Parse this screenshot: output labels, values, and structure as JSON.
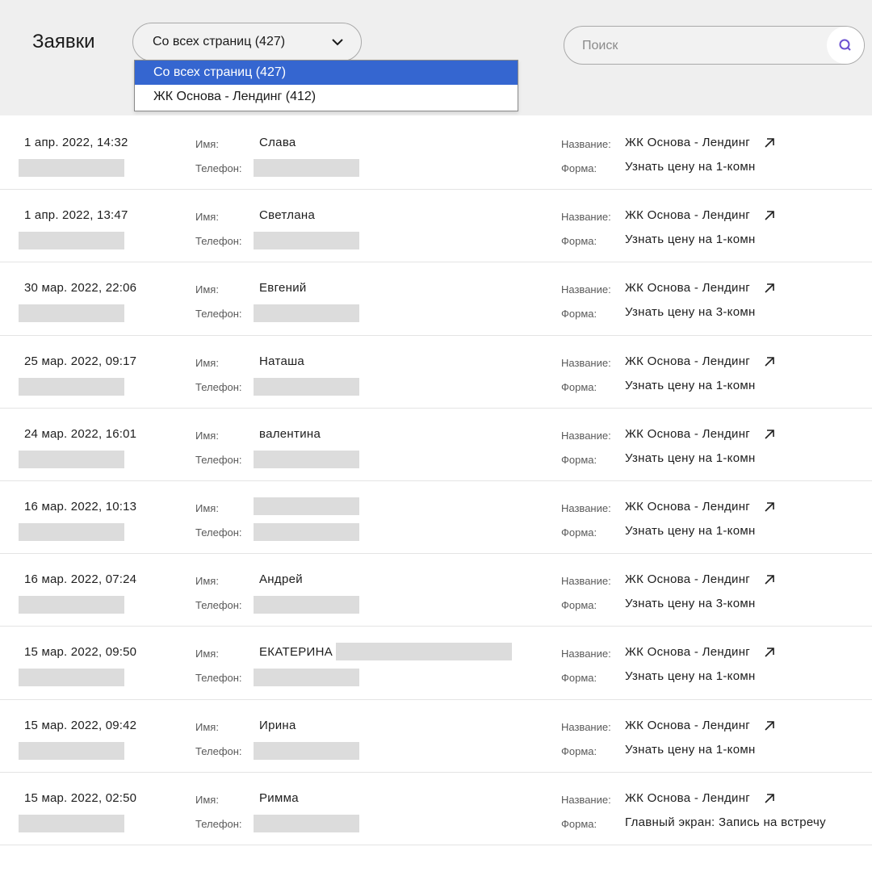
{
  "header": {
    "title": "Заявки",
    "filter_selected": "Со всех страниц (427)",
    "filter_options": [
      "Со всех страниц (427)",
      "ЖК Основа - Лендинг (412)"
    ],
    "search_placeholder": "Поиск"
  },
  "labels": {
    "name": "Имя:",
    "phone": "Телефон:",
    "title": "Название:",
    "form": "Форма:"
  },
  "rows": [
    {
      "date": "1 апр. 2022, 14:32",
      "name": "Слава",
      "title": "ЖК Основа - Лендинг",
      "form": "Узнать цену на 1-комн"
    },
    {
      "date": "1 апр. 2022, 13:47",
      "name": "Светлана",
      "title": "ЖК Основа - Лендинг",
      "form": "Узнать цену на 1-комн"
    },
    {
      "date": "30 мар. 2022, 22:06",
      "name": "Евгений",
      "title": "ЖК Основа - Лендинг",
      "form": "Узнать цену на 3-комн"
    },
    {
      "date": "25 мар. 2022, 09:17",
      "name": "Наташа",
      "title": "ЖК Основа - Лендинг",
      "form": "Узнать цену на 1-комн"
    },
    {
      "date": "24 мар. 2022, 16:01",
      "name": "валентина",
      "title": "ЖК Основа - Лендинг",
      "form": "Узнать цену на 1-комн"
    },
    {
      "date": "16 мар. 2022, 10:13",
      "name": "",
      "title": "ЖК Основа - Лендинг",
      "form": "Узнать цену на 1-комн"
    },
    {
      "date": "16 мар. 2022, 07:24",
      "name": "Андрей",
      "title": "ЖК Основа - Лендинг",
      "form": "Узнать цену на 3-комн"
    },
    {
      "date": "15 мар. 2022, 09:50",
      "name": "ЕКАТЕРИНА",
      "title": "ЖК Основа - Лендинг",
      "form": "Узнать цену на 1-комн"
    },
    {
      "date": "15 мар. 2022, 09:42",
      "name": "Ирина",
      "title": "ЖК Основа - Лендинг",
      "form": "Узнать цену на 1-комн"
    },
    {
      "date": "15 мар. 2022, 02:50",
      "name": "Римма",
      "title": "ЖК Основа - Лендинг",
      "form": "Главный экран: Запись на встречу"
    }
  ]
}
